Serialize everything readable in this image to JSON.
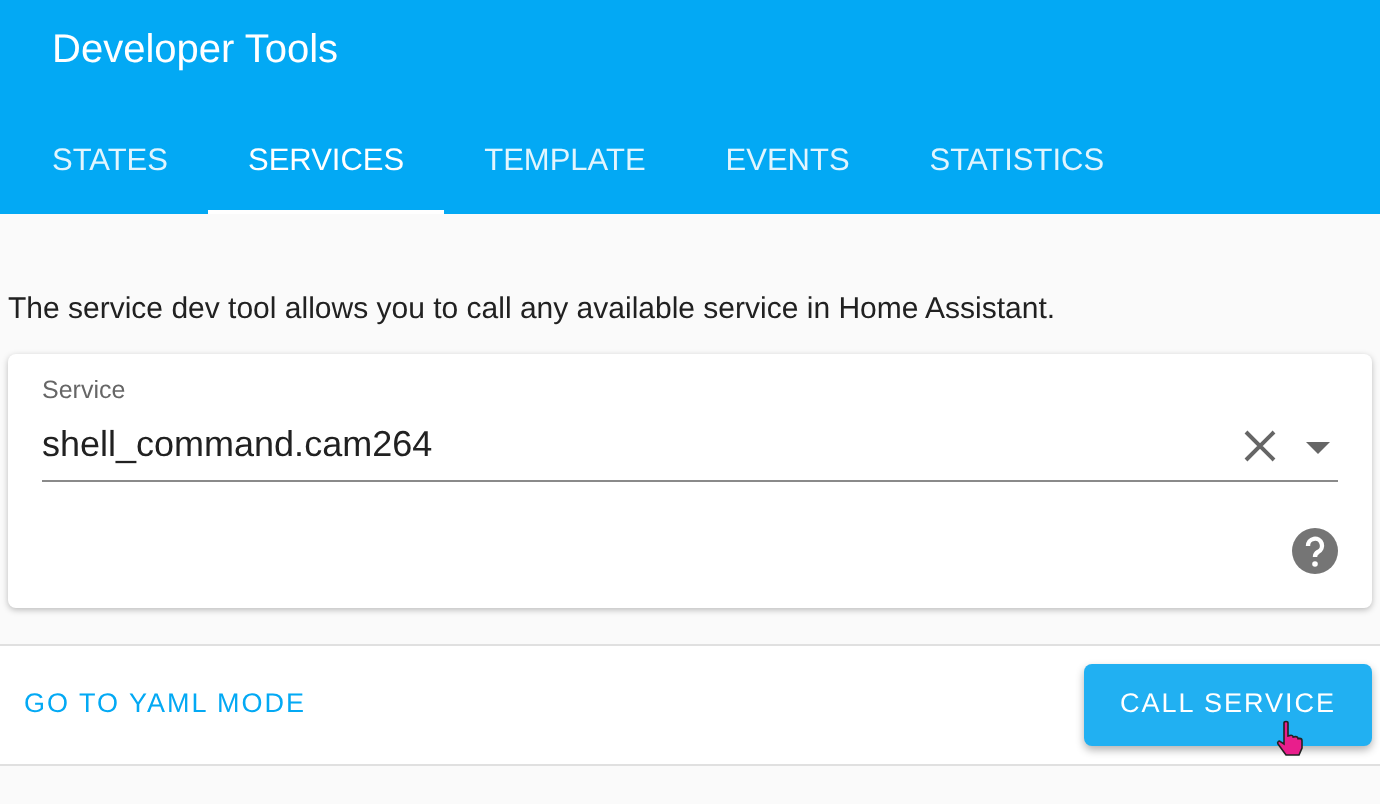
{
  "header": {
    "title": "Developer Tools"
  },
  "tabs": [
    {
      "label": "STATES",
      "selected": false
    },
    {
      "label": "SERVICES",
      "selected": true
    },
    {
      "label": "TEMPLATE",
      "selected": false
    },
    {
      "label": "EVENTS",
      "selected": false
    },
    {
      "label": "STATISTICS",
      "selected": false
    }
  ],
  "description": "The service dev tool allows you to call any available service in Home Assistant.",
  "service_field": {
    "label": "Service",
    "value": "shell_command.cam264"
  },
  "actions": {
    "yaml_link": "GO TO YAML MODE",
    "call_button": "CALL SERVICE"
  }
}
